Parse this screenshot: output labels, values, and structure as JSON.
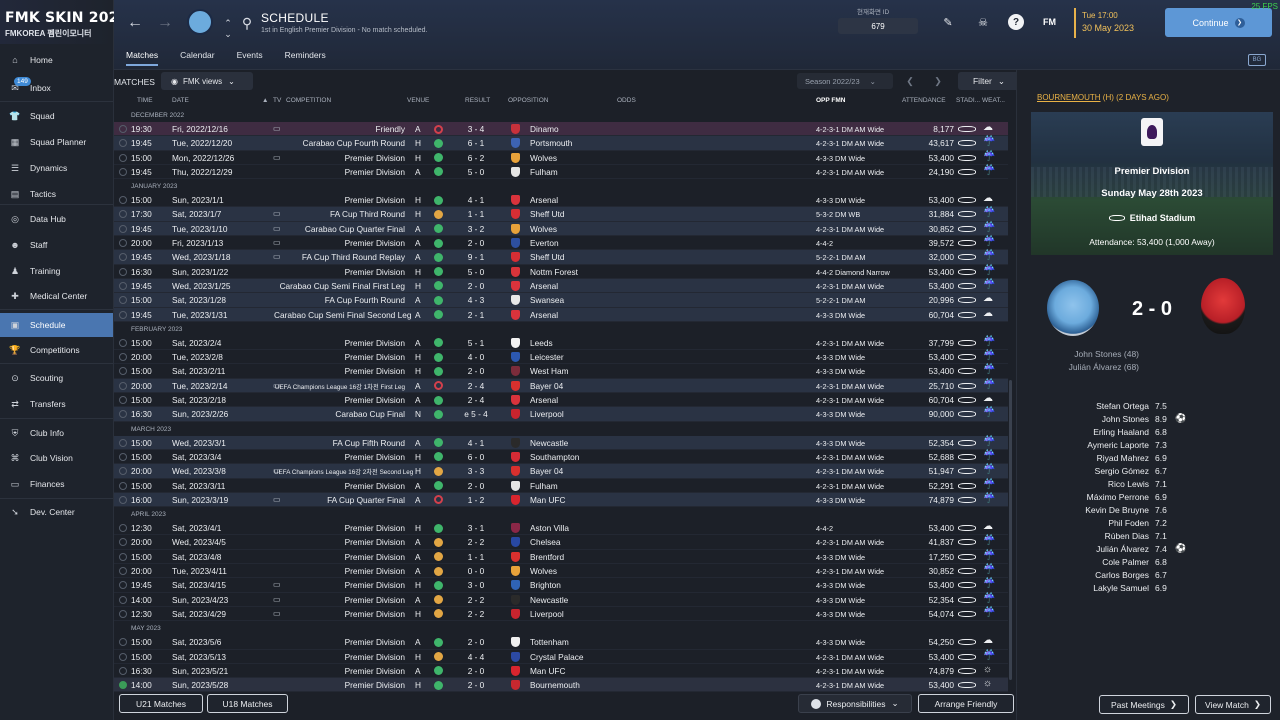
{
  "brand": {
    "title": "FMK SKIN 2023",
    "subtitle": "FMKOREA 펨린이모니터"
  },
  "sidebar": {
    "items": [
      {
        "label": "Home"
      },
      {
        "label": "Inbox",
        "badge": "149"
      },
      {
        "label": "Squad"
      },
      {
        "label": "Squad Planner"
      },
      {
        "label": "Dynamics"
      },
      {
        "label": "Tactics"
      },
      {
        "label": "Data Hub"
      },
      {
        "label": "Staff"
      },
      {
        "label": "Training"
      },
      {
        "label": "Medical Center"
      },
      {
        "label": "Schedule"
      },
      {
        "label": "Competitions"
      },
      {
        "label": "Scouting"
      },
      {
        "label": "Transfers"
      },
      {
        "label": "Club Info"
      },
      {
        "label": "Club Vision"
      },
      {
        "label": "Finances"
      },
      {
        "label": "Dev. Center"
      }
    ]
  },
  "header": {
    "title": "SCHEDULE",
    "subtitle": "1st in English Premier Division - No match scheduled.",
    "tabs": [
      "Matches",
      "Calendar",
      "Events",
      "Reminders"
    ],
    "ident_label": "현재화면 ID",
    "ident_value": "679",
    "fm": "FM",
    "day_time": "Tue 17:00",
    "date": "30 May 2023",
    "continue_label": "Continue",
    "fps": "25 FPS",
    "mini": "BG"
  },
  "toolbar": {
    "matches_label": "MATCHES",
    "views_label": "FMK views",
    "season": "Season 2022/23",
    "filter": "Filter"
  },
  "columns": {
    "time": "TIME",
    "date": "DATE",
    "tv": "TV",
    "competition": "COMPETITION",
    "venue": "VENUE",
    "result": "RESULT",
    "opposition": "OPPOSITION",
    "odds": "ODDS",
    "opp_fmn": "OPP FMN",
    "attendance": "ATTENDANCE",
    "stadium": "STADI...",
    "weather": "WEAT..."
  },
  "months": [
    "DECEMBER 2022",
    "JANUARY 2023",
    "FEBRUARY 2023",
    "MARCH 2023",
    "APRIL 2023",
    "MAY 2023"
  ],
  "matches": [
    {
      "m": 0,
      "time": "19:30",
      "date": "Fri, 2022/12/16",
      "tv": true,
      "comp": "Friendly",
      "venue": "A",
      "res": "loss",
      "score": "3 - 4",
      "opp": "Dinamo",
      "crest": "#c8313b",
      "fmn": "4-2-3-1 DM AM Wide",
      "att": "8,177",
      "w": "☁",
      "cls": "sel"
    },
    {
      "m": 0,
      "time": "19:45",
      "date": "Tue, 2022/12/20",
      "tv": false,
      "comp": "Carabao Cup Fourth Round",
      "venue": "H",
      "res": "win",
      "score": "6 - 1",
      "opp": "Portsmouth",
      "crest": "#3d63b3",
      "fmn": "4-2-3-1 DM AM Wide",
      "att": "43,617",
      "w": "☔",
      "cls": "away"
    },
    {
      "m": 0,
      "time": "15:00",
      "date": "Mon, 2022/12/26",
      "tv": true,
      "comp": "Premier Division",
      "venue": "H",
      "res": "win",
      "score": "6 - 2",
      "opp": "Wolves",
      "crest": "#e8a23a",
      "fmn": "4-3-3 DM Wide",
      "att": "53,400",
      "w": "☔",
      "cls": ""
    },
    {
      "m": 0,
      "time": "19:45",
      "date": "Thu, 2022/12/29",
      "tv": false,
      "comp": "Premier Division",
      "venue": "A",
      "res": "win",
      "score": "5 - 0",
      "opp": "Fulham",
      "crest": "#e5e5e5",
      "fmn": "4-2-3-1 DM AM Wide",
      "att": "24,190",
      "w": "☔",
      "cls": ""
    },
    {
      "m": 1,
      "time": "15:00",
      "date": "Sun, 2023/1/1",
      "tv": false,
      "comp": "Premier Division",
      "venue": "H",
      "res": "win",
      "score": "4 - 1",
      "opp": "Arsenal",
      "crest": "#d9333c",
      "fmn": "4-3-3 DM Wide",
      "att": "53,400",
      "w": "☁",
      "cls": ""
    },
    {
      "m": 1,
      "time": "17:30",
      "date": "Sat, 2023/1/7",
      "tv": true,
      "comp": "FA Cup Third Round",
      "venue": "H",
      "res": "draw",
      "score": "1 - 1",
      "opp": "Sheff Utd",
      "crest": "#d62e34",
      "fmn": "5-3-2 DM WB",
      "att": "31,884",
      "w": "☔",
      "cls": "away"
    },
    {
      "m": 1,
      "time": "19:45",
      "date": "Tue, 2023/1/10",
      "tv": true,
      "comp": "Carabao Cup Quarter Final",
      "venue": "A",
      "res": "win",
      "score": "3 - 2",
      "opp": "Wolves",
      "crest": "#e8a23a",
      "fmn": "4-2-3-1 DM AM Wide",
      "att": "30,852",
      "w": "☔",
      "cls": "away"
    },
    {
      "m": 1,
      "time": "20:00",
      "date": "Fri, 2023/1/13",
      "tv": true,
      "comp": "Premier Division",
      "venue": "A",
      "res": "win",
      "score": "2 - 0",
      "opp": "Everton",
      "crest": "#2d4fa0",
      "fmn": "4-4-2",
      "att": "39,572",
      "w": "☔",
      "cls": ""
    },
    {
      "m": 1,
      "time": "19:45",
      "date": "Wed, 2023/1/18",
      "tv": true,
      "comp": "FA Cup Third Round Replay",
      "venue": "A",
      "res": "win",
      "score": "9 - 1",
      "opp": "Sheff Utd",
      "crest": "#d62e34",
      "fmn": "5-2-2-1 DM AM",
      "att": "32,000",
      "w": "☔",
      "cls": "away"
    },
    {
      "m": 1,
      "time": "16:30",
      "date": "Sun, 2023/1/22",
      "tv": false,
      "comp": "Premier Division",
      "venue": "H",
      "res": "win",
      "score": "5 - 0",
      "opp": "Nottm Forest",
      "crest": "#d8343a",
      "fmn": "4-4-2 Diamond Narrow",
      "att": "53,400",
      "w": "☔",
      "cls": ""
    },
    {
      "m": 1,
      "time": "19:45",
      "date": "Wed, 2023/1/25",
      "tv": false,
      "comp": "Carabao Cup Semi Final First Leg",
      "venue": "H",
      "res": "win",
      "score": "2 - 0",
      "opp": "Arsenal",
      "crest": "#d9333c",
      "fmn": "4-2-3-1 DM AM Wide",
      "att": "53,400",
      "w": "☔",
      "cls": "away"
    },
    {
      "m": 1,
      "time": "15:00",
      "date": "Sat, 2023/1/28",
      "tv": false,
      "comp": "FA Cup Fourth Round",
      "venue": "A",
      "res": "win",
      "score": "4 - 3",
      "opp": "Swansea",
      "crest": "#e8e8e8",
      "fmn": "5-2-2-1 DM AM",
      "att": "20,996",
      "w": "☁",
      "cls": "away"
    },
    {
      "m": 1,
      "time": "19:45",
      "date": "Tue, 2023/1/31",
      "tv": false,
      "comp": "Carabao Cup Semi Final Second Leg",
      "venue": "A",
      "res": "win",
      "score": "2 - 1",
      "opp": "Arsenal",
      "crest": "#d9333c",
      "fmn": "4-3-3 DM Wide",
      "att": "60,704",
      "w": "☁",
      "cls": "away"
    },
    {
      "m": 2,
      "time": "15:00",
      "date": "Sat, 2023/2/4",
      "tv": false,
      "comp": "Premier Division",
      "venue": "A",
      "res": "win",
      "score": "5 - 1",
      "opp": "Leeds",
      "crest": "#f2f2f2",
      "fmn": "4-2-3-1 DM AM Wide",
      "att": "37,799",
      "w": "☔",
      "cls": ""
    },
    {
      "m": 2,
      "time": "20:00",
      "date": "Tue, 2023/2/8",
      "tv": false,
      "comp": "Premier Division",
      "venue": "H",
      "res": "win",
      "score": "4 - 0",
      "opp": "Leicester",
      "crest": "#2c58b0",
      "fmn": "4-3-3 DM Wide",
      "att": "53,400",
      "w": "☔",
      "cls": ""
    },
    {
      "m": 2,
      "time": "15:00",
      "date": "Sat, 2023/2/11",
      "tv": false,
      "comp": "Premier Division",
      "venue": "H",
      "res": "win",
      "score": "2 - 0",
      "opp": "West Ham",
      "crest": "#7c2c3b",
      "fmn": "4-3-3 DM Wide",
      "att": "53,400",
      "w": "☔",
      "cls": ""
    },
    {
      "m": 2,
      "time": "20:00",
      "date": "Tue, 2023/2/14",
      "tv": true,
      "comp": "UEFA Champions League 16강 1차전 First Leg",
      "venue": "A",
      "res": "loss",
      "score": "2 - 4",
      "opp": "Bayer 04",
      "crest": "#d8302e",
      "fmn": "4-2-3-1 DM AM Wide",
      "att": "25,710",
      "w": "☔",
      "cls": "away",
      "small": true
    },
    {
      "m": 2,
      "time": "15:00",
      "date": "Sat, 2023/2/18",
      "tv": false,
      "comp": "Premier Division",
      "venue": "A",
      "res": "win",
      "score": "2 - 4",
      "opp": "Arsenal",
      "crest": "#d9333c",
      "fmn": "4-2-3-1 DM AM Wide",
      "att": "60,704",
      "w": "☁",
      "cls": ""
    },
    {
      "m": 2,
      "time": "16:30",
      "date": "Sun, 2023/2/26",
      "tv": false,
      "comp": "Carabao Cup Final",
      "venue": "N",
      "res": "win",
      "score": "e 5 - 4",
      "opp": "Liverpool",
      "crest": "#c9242e",
      "fmn": "4-3-3 DM Wide",
      "att": "90,000",
      "w": "☔",
      "cls": "away"
    },
    {
      "m": 3,
      "time": "15:00",
      "date": "Wed, 2023/3/1",
      "tv": false,
      "comp": "FA Cup Fifth Round",
      "venue": "A",
      "res": "win",
      "score": "4 - 1",
      "opp": "Newcastle",
      "crest": "#2a2a2a",
      "fmn": "4-3-3 DM Wide",
      "att": "52,354",
      "w": "☔",
      "cls": "away"
    },
    {
      "m": 3,
      "time": "15:00",
      "date": "Sat, 2023/3/4",
      "tv": false,
      "comp": "Premier Division",
      "venue": "H",
      "res": "win",
      "score": "6 - 0",
      "opp": "Southampton",
      "crest": "#d52b35",
      "fmn": "4-2-3-1 DM AM Wide",
      "att": "52,688",
      "w": "☔",
      "cls": ""
    },
    {
      "m": 3,
      "time": "20:00",
      "date": "Wed, 2023/3/8",
      "tv": true,
      "comp": "UEFA Champions League 16강 2차전 Second Leg",
      "venue": "H",
      "res": "draw",
      "score": "3 - 3",
      "opp": "Bayer 04",
      "crest": "#d8302e",
      "fmn": "4-2-3-1 DM AM Wide",
      "att": "51,947",
      "w": "☔",
      "cls": "away",
      "small": true
    },
    {
      "m": 3,
      "time": "15:00",
      "date": "Sat, 2023/3/11",
      "tv": false,
      "comp": "Premier Division",
      "venue": "A",
      "res": "win",
      "score": "2 - 0",
      "opp": "Fulham",
      "crest": "#e5e5e5",
      "fmn": "4-2-3-1 DM AM Wide",
      "att": "52,291",
      "w": "☔",
      "cls": ""
    },
    {
      "m": 3,
      "time": "16:00",
      "date": "Sun, 2023/3/19",
      "tv": true,
      "comp": "FA Cup Quarter Final",
      "venue": "A",
      "res": "loss",
      "score": "1 - 2",
      "opp": "Man UFC",
      "crest": "#d8252e",
      "fmn": "4-3-3 DM Wide",
      "att": "74,879",
      "w": "☔",
      "cls": "away"
    },
    {
      "m": 4,
      "time": "12:30",
      "date": "Sat, 2023/4/1",
      "tv": false,
      "comp": "Premier Division",
      "venue": "H",
      "res": "win",
      "score": "3 - 1",
      "opp": "Aston Villa",
      "crest": "#8a2747",
      "fmn": "4-4-2",
      "att": "53,400",
      "w": "☁",
      "cls": ""
    },
    {
      "m": 4,
      "time": "20:00",
      "date": "Wed, 2023/4/5",
      "tv": false,
      "comp": "Premier Division",
      "venue": "A",
      "res": "draw",
      "score": "2 - 2",
      "opp": "Chelsea",
      "crest": "#2848a3",
      "fmn": "4-2-3-1 DM AM Wide",
      "att": "41,837",
      "w": "☔",
      "cls": ""
    },
    {
      "m": 4,
      "time": "15:00",
      "date": "Sat, 2023/4/8",
      "tv": false,
      "comp": "Premier Division",
      "venue": "A",
      "res": "draw",
      "score": "1 - 1",
      "opp": "Brentford",
      "crest": "#d8302e",
      "fmn": "4-3-3 DM Wide",
      "att": "17,250",
      "w": "☔",
      "cls": ""
    },
    {
      "m": 4,
      "time": "20:00",
      "date": "Tue, 2023/4/11",
      "tv": false,
      "comp": "Premier Division",
      "venue": "A",
      "res": "draw",
      "score": "0 - 0",
      "opp": "Wolves",
      "crest": "#e8a23a",
      "fmn": "4-2-3-1 DM AM Wide",
      "att": "30,852",
      "w": "☔",
      "cls": ""
    },
    {
      "m": 4,
      "time": "19:45",
      "date": "Sat, 2023/4/15",
      "tv": true,
      "comp": "Premier Division",
      "venue": "H",
      "res": "win",
      "score": "3 - 0",
      "opp": "Brighton",
      "crest": "#2f63b5",
      "fmn": "4-3-3 DM Wide",
      "att": "53,400",
      "w": "☔",
      "cls": ""
    },
    {
      "m": 4,
      "time": "14:00",
      "date": "Sun, 2023/4/23",
      "tv": true,
      "comp": "Premier Division",
      "venue": "A",
      "res": "draw",
      "score": "2 - 2",
      "opp": "Newcastle",
      "crest": "#2a2a2a",
      "fmn": "4-3-3 DM Wide",
      "att": "52,354",
      "w": "☔",
      "cls": ""
    },
    {
      "m": 4,
      "time": "12:30",
      "date": "Sat, 2023/4/29",
      "tv": true,
      "comp": "Premier Division",
      "venue": "H",
      "res": "draw",
      "score": "2 - 2",
      "opp": "Liverpool",
      "crest": "#c9242e",
      "fmn": "4-3-3 DM Wide",
      "att": "54,074",
      "w": "☔",
      "cls": ""
    },
    {
      "m": 5,
      "time": "15:00",
      "date": "Sat, 2023/5/6",
      "tv": false,
      "comp": "Premier Division",
      "venue": "A",
      "res": "win",
      "score": "2 - 0",
      "opp": "Tottenham",
      "crest": "#f0f0f0",
      "fmn": "4-3-3 DM Wide",
      "att": "54,250",
      "w": "☁",
      "cls": ""
    },
    {
      "m": 5,
      "time": "15:00",
      "date": "Sat, 2023/5/13",
      "tv": false,
      "comp": "Premier Division",
      "venue": "H",
      "res": "draw",
      "score": "4 - 4",
      "opp": "Crystal Palace",
      "crest": "#2c4aa3",
      "fmn": "4-2-3-1 DM AM Wide",
      "att": "53,400",
      "w": "☔",
      "cls": ""
    },
    {
      "m": 5,
      "time": "16:30",
      "date": "Sun, 2023/5/21",
      "tv": false,
      "comp": "Premier Division",
      "venue": "A",
      "res": "win",
      "score": "2 - 0",
      "opp": "Man UFC",
      "crest": "#d8252e",
      "fmn": "4-2-3-1 DM AM Wide",
      "att": "74,879",
      "w": "☼",
      "cls": ""
    },
    {
      "m": 5,
      "time": "14:00",
      "date": "Sun, 2023/5/28",
      "tv": false,
      "comp": "Premier Division",
      "venue": "H",
      "res": "win",
      "score": "2 - 0",
      "opp": "Bournemouth",
      "crest": "#c7282f",
      "fmn": "4-2-3-1 DM AM Wide",
      "att": "53,400",
      "w": "☼",
      "cls": "last",
      "done": true
    }
  ],
  "bottom": {
    "u21": "U21 Matches",
    "u18": "U18 Matches",
    "responsibilities": "Responsibilities",
    "arrange": "Arrange Friendly"
  },
  "right": {
    "recent_team": "BOURNEMOUTH",
    "recent_rest": " (H) (2 DAYS AGO)",
    "competition": "Premier Division",
    "match_date": "Sunday May 28th 2023",
    "venue": "Etihad Stadium",
    "attendance": "Attendance: 53,400 (1,000 Away)",
    "score": "2 - 0",
    "scorers": [
      "John Stones (48)",
      "Julián Álvarez (68)"
    ],
    "players": [
      {
        "name": "Stefan Ortega",
        "rating": "7.5",
        "star": false
      },
      {
        "name": "John Stones",
        "rating": "8.9",
        "star": true
      },
      {
        "name": "Erling Haaland",
        "rating": "6.8",
        "star": false
      },
      {
        "name": "Aymeric Laporte",
        "rating": "7.3",
        "star": false
      },
      {
        "name": "Riyad Mahrez",
        "rating": "6.9",
        "star": false
      },
      {
        "name": "Sergio Gómez",
        "rating": "6.7",
        "star": false
      },
      {
        "name": "Rico Lewis",
        "rating": "7.1",
        "star": false
      },
      {
        "name": "Máximo Perrone",
        "rating": "6.9",
        "star": false
      },
      {
        "name": "Kevin De Bruyne",
        "rating": "7.6",
        "star": false
      },
      {
        "name": "Phil Foden",
        "rating": "7.2",
        "star": false
      },
      {
        "name": "Rúben Dias",
        "rating": "7.1",
        "star": false
      },
      {
        "name": "Julián Álvarez",
        "rating": "7.4",
        "star": true
      },
      {
        "name": "Cole Palmer",
        "rating": "6.8",
        "star": false
      },
      {
        "name": "Carlos Borges",
        "rating": "6.7",
        "star": false
      },
      {
        "name": "Lakyle Samuel",
        "rating": "6.9",
        "star": false
      }
    ],
    "past_meetings": "Past Meetings",
    "view_match": "View Match"
  },
  "colors": {
    "accent": "#4a76b0",
    "win": "#3fb56b",
    "draw": "#e2a644",
    "loss": "#d3404c",
    "date": "#f1c15b"
  }
}
